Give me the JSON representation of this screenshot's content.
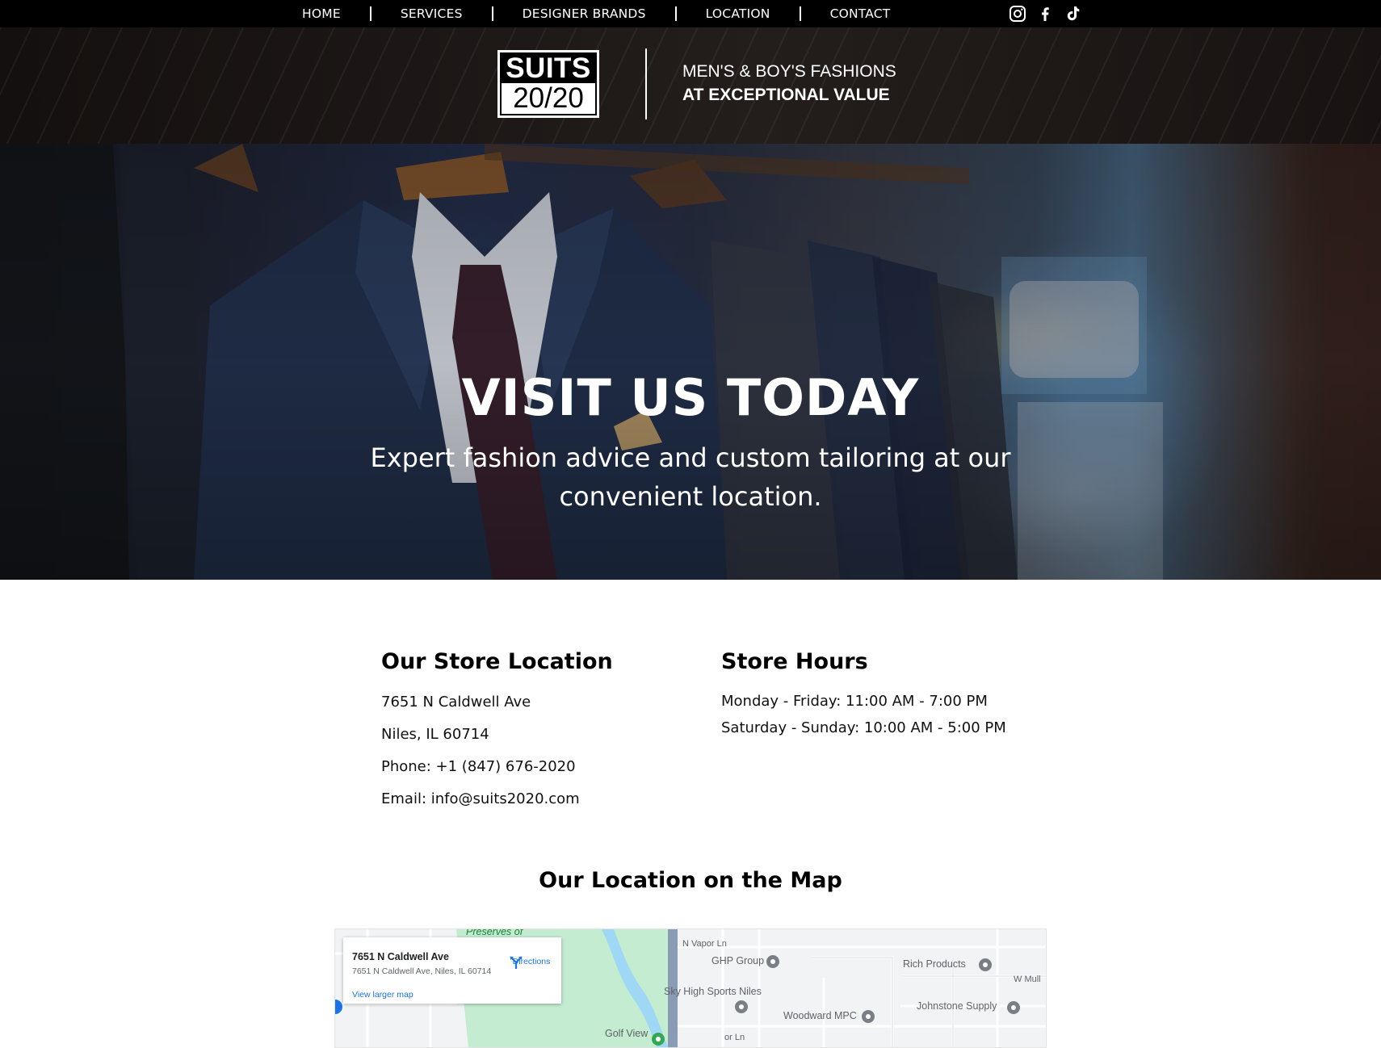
{
  "nav": {
    "items": [
      {
        "label": "HOME"
      },
      {
        "label": "SERVICES"
      },
      {
        "label": "DESIGNER BRANDS"
      },
      {
        "label": "LOCATION"
      },
      {
        "label": "CONTACT"
      }
    ],
    "social": [
      "instagram-icon",
      "facebook-icon",
      "tiktok-icon"
    ]
  },
  "brand": {
    "logo_top": "SUITS",
    "logo_bottom": "20/20",
    "tagline_line1": "MEN'S & BOY'S FASHIONS",
    "tagline_line2": "AT EXCEPTIONAL VALUE"
  },
  "hero": {
    "title": "VISIT US TODAY",
    "subtitle": "Expert fashion advice and custom tailoring at our convenient location."
  },
  "location": {
    "heading": "Our Store Location",
    "street": "7651 N Caldwell Ave",
    "city": "Niles, IL 60714",
    "phone_label": "Phone: ",
    "phone": "+1 (847) 676-2020",
    "email_label": "Email: ",
    "email": "info@suits2020.com"
  },
  "hours": {
    "heading": "Store Hours",
    "weekday": "Monday - Friday: 11:00 AM - 7:00 PM",
    "weekend": "Saturday - Sunday: 10:00 AM - 5:00 PM"
  },
  "map": {
    "heading": "Our Location on the Map",
    "card_title": "7651 N Caldwell Ave",
    "card_address": "7651 N Caldwell Ave, Niles, IL 60714",
    "directions": "Directions",
    "view_larger": "View larger map",
    "labels": {
      "preserves": "Preserves of",
      "vapor": "N Vapor Ln",
      "ghp": "GHP Group",
      "rich": "Rich Products",
      "wmul": "W Mull",
      "sky": "Sky High Sports Niles",
      "johnstone": "Johnstone Supply",
      "woodward": "Woodward MPC",
      "golf": "Golf View",
      "orln": "or Ln"
    },
    "colors": {
      "park": "#c3ecd0",
      "water": "#9fd8f5",
      "road": "#ffffff",
      "highway": "#8a9bb5",
      "pin": "#7a7f87"
    }
  }
}
